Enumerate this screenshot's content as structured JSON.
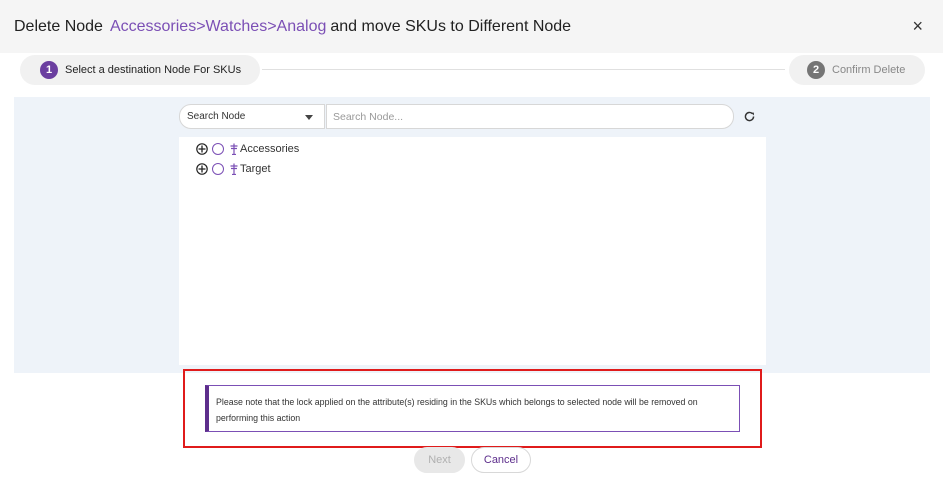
{
  "header": {
    "title": "Delete Node",
    "path": "Accessories>Watches>Analog",
    "rest": "and move SKUs to Different Node",
    "close": "×"
  },
  "steps": [
    {
      "number": "1",
      "label": "Select a destination Node For SKUs",
      "state": "active"
    },
    {
      "number": "2",
      "label": "Confirm Delete",
      "state": "inactive"
    }
  ],
  "search": {
    "select_value": "Search Node",
    "placeholder": "Search Node..."
  },
  "tree": {
    "items": [
      {
        "label": "Accessories"
      },
      {
        "label": "Target"
      }
    ]
  },
  "note": {
    "text": "Please note that the lock applied on the attribute(s) residing in the SKUs which belongs to selected node will be removed on performing this action"
  },
  "buttons": {
    "next": "Next",
    "cancel": "Cancel"
  },
  "colors": {
    "accent": "#7b4fb5",
    "step_active": "#6b3fa0",
    "highlight": "#e01b1b"
  }
}
